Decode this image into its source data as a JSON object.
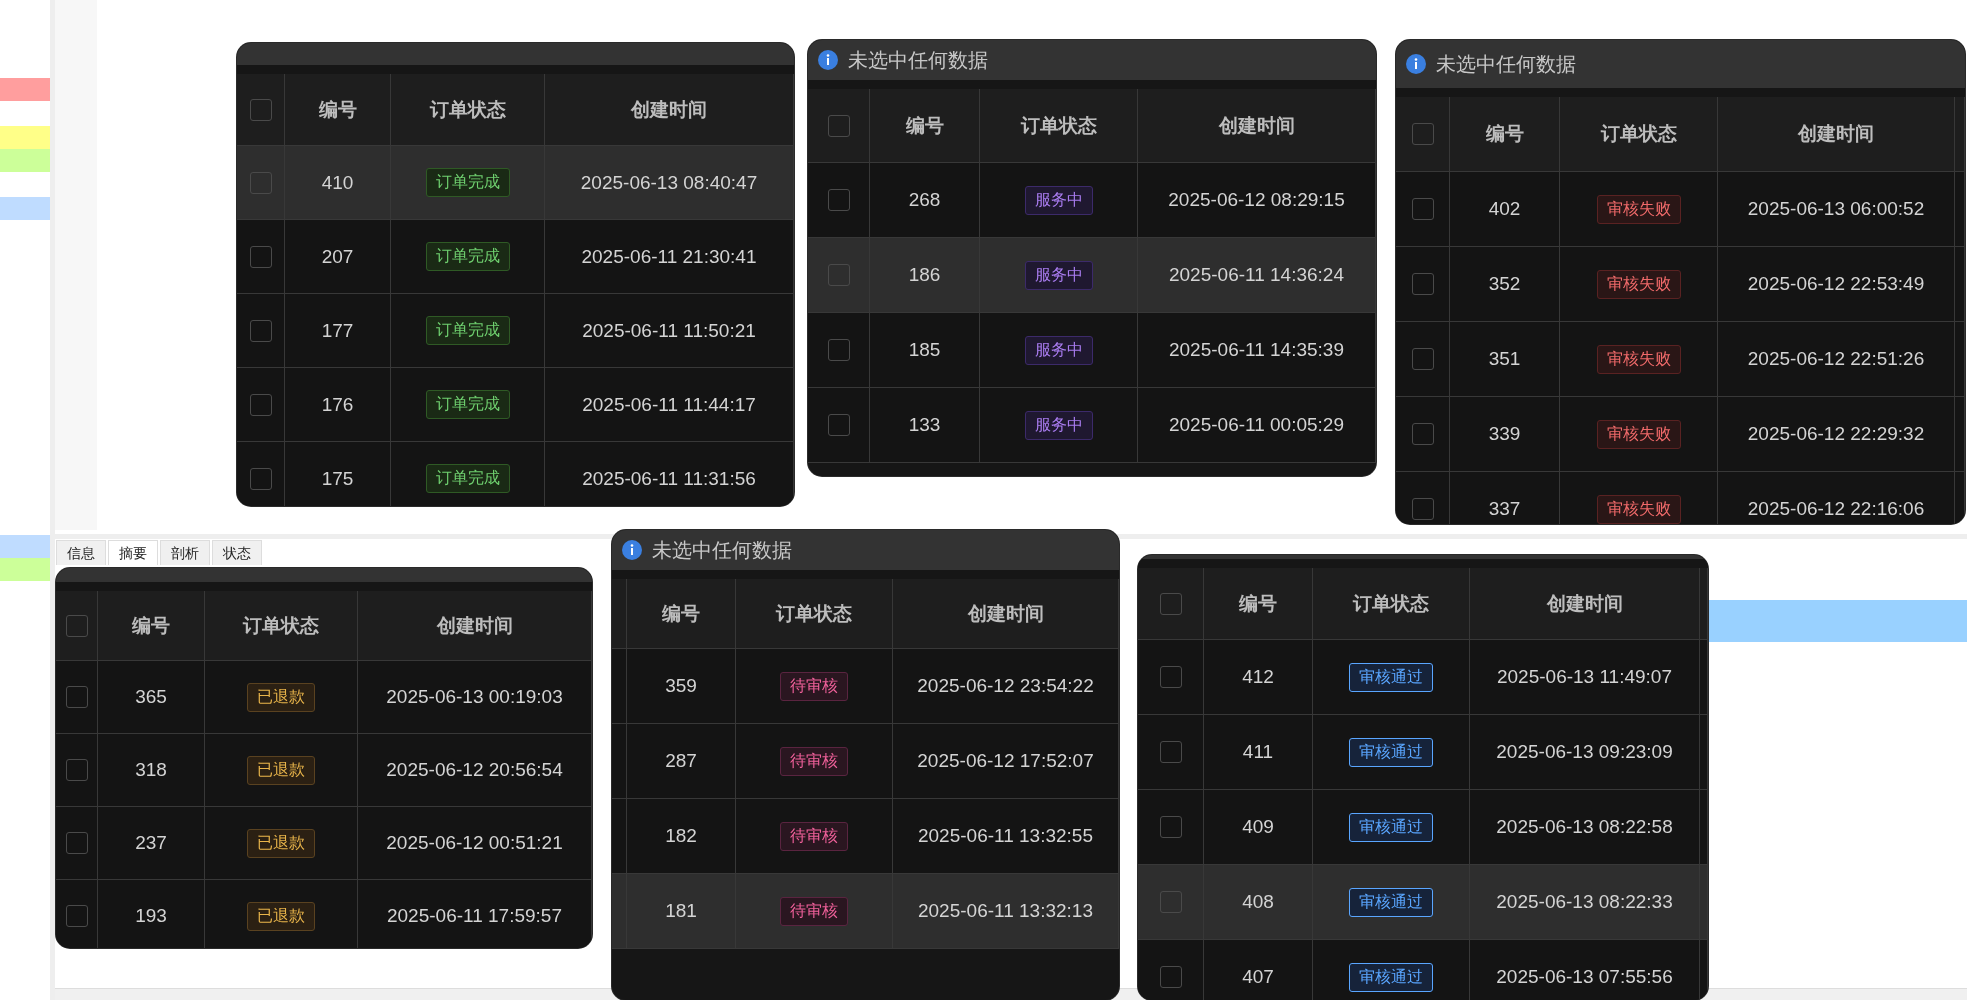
{
  "background_tabs": [
    {
      "label": "信息",
      "selected": false
    },
    {
      "label": "摘要",
      "selected": true
    },
    {
      "label": "剖析",
      "selected": false
    },
    {
      "label": "状态",
      "selected": false
    }
  ],
  "tables": [
    {
      "kind": "done",
      "columns": [
        "编号",
        "订单状态",
        "创建时间"
      ],
      "all_checked": false,
      "rows": [
        {
          "id": "410",
          "status": "订单完成",
          "created": "2025-06-13 08:40:47",
          "checked": false,
          "highlighted": true
        },
        {
          "id": "207",
          "status": "订单完成",
          "created": "2025-06-11 21:30:41",
          "checked": false,
          "highlighted": false
        },
        {
          "id": "177",
          "status": "订单完成",
          "created": "2025-06-11 11:50:21",
          "checked": false,
          "highlighted": false
        },
        {
          "id": "176",
          "status": "订单完成",
          "created": "2025-06-11 11:44:17",
          "checked": false,
          "highlighted": false
        },
        {
          "id": "175",
          "status": "订单完成",
          "created": "2025-06-11 11:31:56",
          "checked": false,
          "highlighted": false
        }
      ]
    },
    {
      "title": "未选中任何数据",
      "kind": "service",
      "columns": [
        "编号",
        "订单状态",
        "创建时间"
      ],
      "all_checked": false,
      "rows": [
        {
          "id": "268",
          "status": "服务中",
          "created": "2025-06-12 08:29:15",
          "checked": false,
          "highlighted": false
        },
        {
          "id": "186",
          "status": "服务中",
          "created": "2025-06-11 14:36:24",
          "checked": false,
          "highlighted": true
        },
        {
          "id": "185",
          "status": "服务中",
          "created": "2025-06-11 14:35:39",
          "checked": false,
          "highlighted": false
        },
        {
          "id": "133",
          "status": "服务中",
          "created": "2025-06-11 00:05:29",
          "checked": false,
          "highlighted": false
        }
      ]
    },
    {
      "title": "未选中任何数据",
      "kind": "failed",
      "columns": [
        "编号",
        "订单状态",
        "创建时间"
      ],
      "all_checked": false,
      "rows": [
        {
          "id": "402",
          "status": "审核失败",
          "created": "2025-06-13 06:00:52",
          "checked": false,
          "highlighted": false
        },
        {
          "id": "352",
          "status": "审核失败",
          "created": "2025-06-12 22:53:49",
          "checked": false,
          "highlighted": false
        },
        {
          "id": "351",
          "status": "审核失败",
          "created": "2025-06-12 22:51:26",
          "checked": false,
          "highlighted": false
        },
        {
          "id": "339",
          "status": "审核失败",
          "created": "2025-06-12 22:29:32",
          "checked": false,
          "highlighted": false
        },
        {
          "id": "337",
          "status": "审核失败",
          "created": "2025-06-12 22:16:06",
          "checked": false,
          "highlighted": false
        }
      ]
    },
    {
      "kind": "refunded",
      "columns": [
        "编号",
        "订单状态",
        "创建时间"
      ],
      "all_checked": false,
      "rows": [
        {
          "id": "365",
          "status": "已退款",
          "created": "2025-06-13 00:19:03",
          "checked": false,
          "highlighted": false
        },
        {
          "id": "318",
          "status": "已退款",
          "created": "2025-06-12 20:56:54",
          "checked": false,
          "highlighted": false
        },
        {
          "id": "237",
          "status": "已退款",
          "created": "2025-06-12 00:51:21",
          "checked": false,
          "highlighted": false
        },
        {
          "id": "193",
          "status": "已退款",
          "created": "2025-06-11 17:59:57",
          "checked": false,
          "highlighted": false
        }
      ]
    },
    {
      "title": "未选中任何数据",
      "kind": "pending",
      "columns": [
        "编号",
        "订单状态",
        "创建时间"
      ],
      "rows": [
        {
          "id": "359",
          "status": "待审核",
          "created": "2025-06-12 23:54:22",
          "highlighted": false
        },
        {
          "id": "287",
          "status": "待审核",
          "created": "2025-06-12 17:52:07",
          "highlighted": false
        },
        {
          "id": "182",
          "status": "待审核",
          "created": "2025-06-11 13:32:55",
          "highlighted": false
        },
        {
          "id": "181",
          "status": "待审核",
          "created": "2025-06-11 13:32:13",
          "highlighted": true
        }
      ]
    },
    {
      "kind": "approved",
      "columns": [
        "编号",
        "订单状态",
        "创建时间"
      ],
      "all_checked": false,
      "rows": [
        {
          "id": "412",
          "status": "审核通过",
          "created": "2025-06-13 11:49:07",
          "checked": false,
          "highlighted": false
        },
        {
          "id": "411",
          "status": "审核通过",
          "created": "2025-06-13 09:23:09",
          "checked": false,
          "highlighted": false
        },
        {
          "id": "409",
          "status": "审核通过",
          "created": "2025-06-13 08:22:58",
          "checked": false,
          "highlighted": false
        },
        {
          "id": "408",
          "status": "审核通过",
          "created": "2025-06-13 08:22:33",
          "checked": false,
          "highlighted": true
        },
        {
          "id": "407",
          "status": "审核通过",
          "created": "2025-06-13 07:55:56",
          "checked": false,
          "highlighted": false
        }
      ]
    }
  ]
}
